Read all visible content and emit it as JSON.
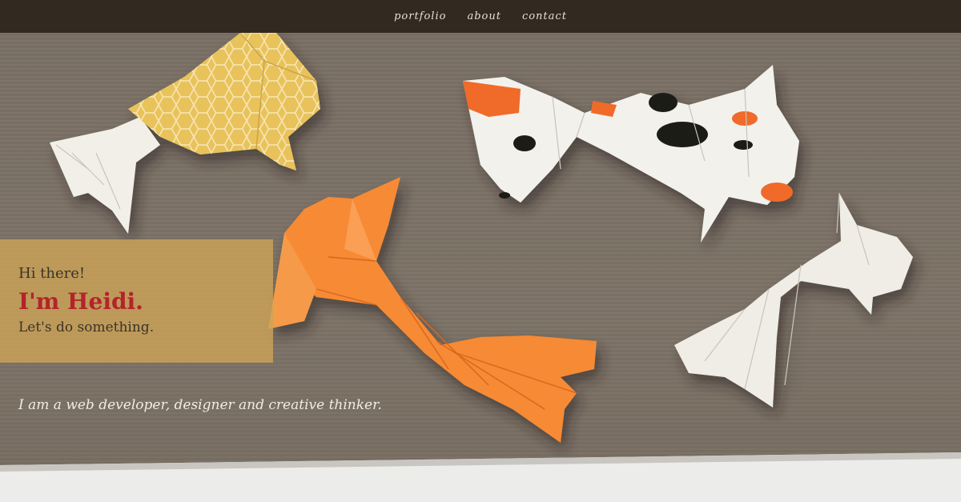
{
  "nav": {
    "items": [
      {
        "label": "portfolio"
      },
      {
        "label": "about"
      },
      {
        "label": "contact"
      }
    ]
  },
  "intro": {
    "greeting": "Hi there!",
    "name": "I'm Heidi.",
    "cta": "Let's do something."
  },
  "tagline": "I am a web developer, designer and creative thinker.",
  "colors": {
    "nav_bg": "#322a20",
    "card_bg": "#cda456",
    "name_accent": "#b4232a",
    "wall": "#7c7266"
  },
  "hero_image": {
    "subjects": [
      "yellow-origami-koi",
      "orange-origami-koi",
      "white-spotted-origami-koi",
      "white-origami-koi"
    ]
  }
}
